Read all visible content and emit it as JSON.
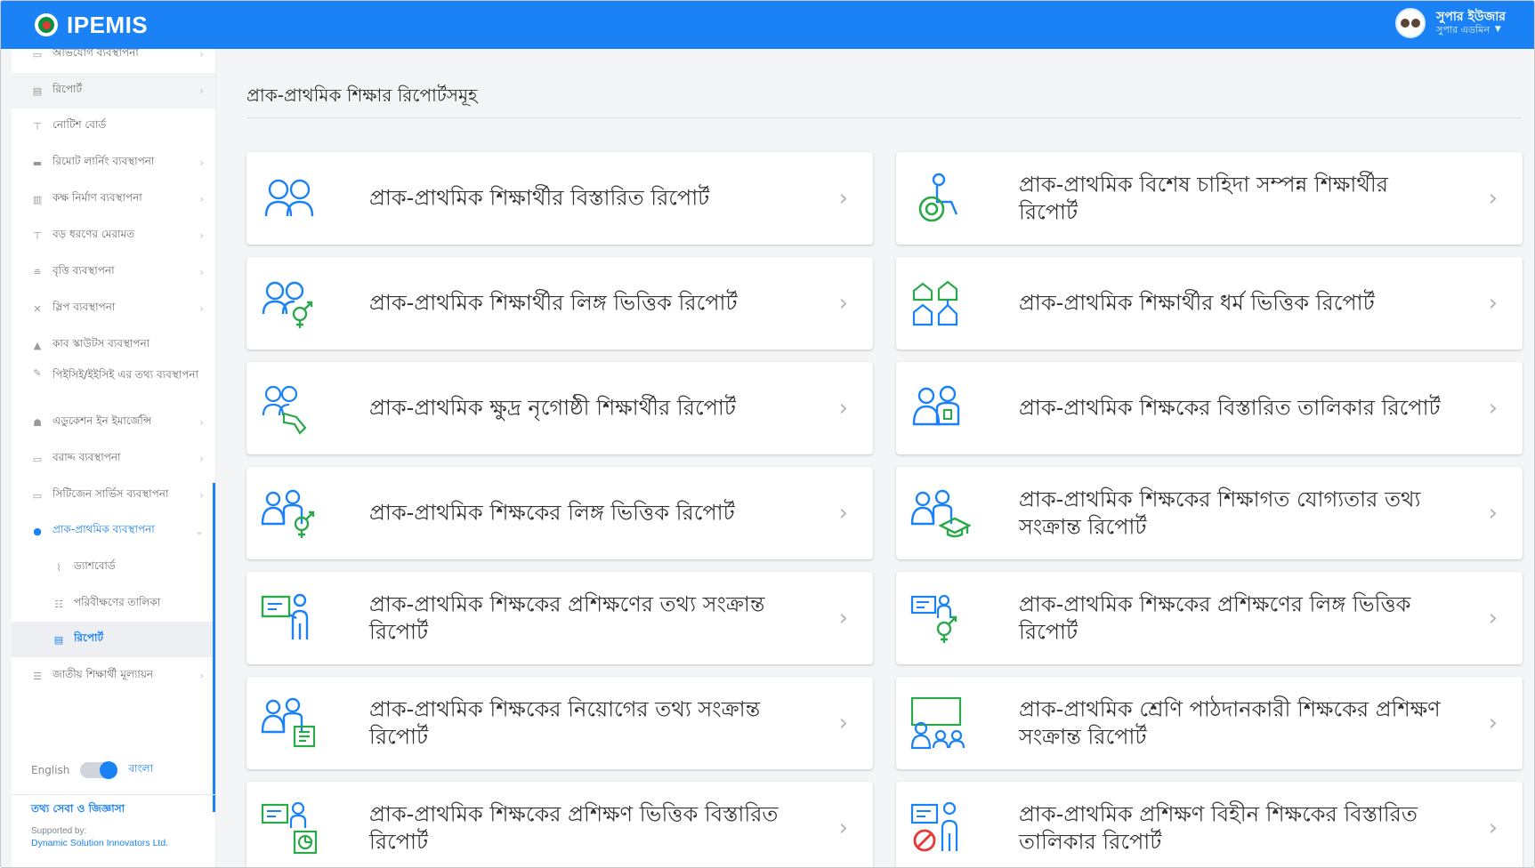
{
  "app": {
    "brand": "IPEMIS"
  },
  "user": {
    "name": "সুপার ইউজার",
    "role": "সুপার এডমিন"
  },
  "sidebar": {
    "items": [
      {
        "label": "অভিযোগ ব্যবস্থাপনা",
        "icon": "complaint-icon"
      },
      {
        "label": "রিপোর্ট",
        "icon": "report-icon"
      },
      {
        "label": "নোটিশ বোর্ড",
        "icon": "pin-icon"
      },
      {
        "label": "রিমোট লার্নিং ব্যবস্থাপনা",
        "icon": "folder-icon"
      },
      {
        "label": "কক্ষ নির্মাণ ব্যবস্থাপনা",
        "icon": "building-icon"
      },
      {
        "label": "বড় ধরণের মেরামত",
        "icon": "repair-icon"
      },
      {
        "label": "বৃত্তি ব্যবস্থাপনা",
        "icon": "scholarship-icon"
      },
      {
        "label": "স্লিপ ব্যবস্থাপনা",
        "icon": "tools-icon"
      },
      {
        "label": "কাব স্কাউটস ব্যবস্থাপনা",
        "icon": "tent-icon"
      },
      {
        "label": "পিইসিই/ইইসিই এর তথ্য ব্যবস্থাপনা",
        "icon": "edit-icon"
      },
      {
        "label": "এডুকেশন ইন ইমার্জেন্সি",
        "icon": "emergency-icon"
      },
      {
        "label": "বরাদ্দ ব্যবস্থাপনা",
        "icon": "allocation-icon"
      },
      {
        "label": "সিটিজেন সার্ভিস ব্যবস্থাপনা",
        "icon": "service-icon"
      },
      {
        "label": "প্রাক-প্রাথমিক ব্যবস্থাপনা",
        "icon": "pre-primary-icon"
      },
      {
        "label": "ড্যাশবোর্ড",
        "icon": "chart-line-icon"
      },
      {
        "label": "পরিবীক্ষণের তালিকা",
        "icon": "list-icon"
      },
      {
        "label": "রিপোর্ট",
        "icon": "report-icon"
      },
      {
        "label": "জাতীয় শিক্ষার্থী মূল্যায়ন",
        "icon": "assessment-icon"
      }
    ],
    "lang_en": "English",
    "lang_bn": "বাংলা",
    "footer_link": "তথ্য সেবা ও জিজ্ঞাসা",
    "supported_by": "Supported by:",
    "company": "Dynamic Solution Innovators Ltd."
  },
  "main": {
    "title": "প্রাক-প্রাথমিক শিক্ষার রিপোর্টসমূহ",
    "cards": [
      {
        "label": "প্রাক-প্রাথমিক শিক্ষার্থীর বিস্তারিত রিপোর্ট",
        "icon": "students-icon"
      },
      {
        "label": "প্রাক-প্রাথমিক বিশেষ চাহিদা সম্পন্ন শিক্ষার্থীর রিপোর্ট",
        "icon": "wheelchair-icon"
      },
      {
        "label": "প্রাক-প্রাথমিক শিক্ষার্থীর লিঙ্গ ভিত্তিক রিপোর্ট",
        "icon": "students-gender-icon"
      },
      {
        "label": "প্রাক-প্রাথমিক শিক্ষার্থীর ধর্ম ভিত্তিক রিপোর্ট",
        "icon": "religion-icon"
      },
      {
        "label": "প্রাক-প্রাথমিক ক্ষুদ্র নৃগোষ্ঠী শিক্ষার্থীর রিপোর্ট",
        "icon": "ethnic-students-icon"
      },
      {
        "label": "প্রাক-প্রাথমিক শিক্ষকের বিস্তারিত তালিকার রিপোর্ট",
        "icon": "teachers-icon"
      },
      {
        "label": "প্রাক-প্রাথমিক শিক্ষকের লিঙ্গ ভিত্তিক রিপোর্ট",
        "icon": "teachers-gender-icon"
      },
      {
        "label": "প্রাক-প্রাথমিক শিক্ষকের শিক্ষাগত যোগ্যতার তথ্য সংক্রান্ত রিপোর্ট",
        "icon": "teachers-graduation-icon"
      },
      {
        "label": "প্রাক-প্রাথমিক শিক্ষকের প্রশিক্ষণের তথ্য সংক্রান্ত রিপোর্ট",
        "icon": "training-icon"
      },
      {
        "label": "প্রাক-প্রাথমিক শিক্ষকের প্রশিক্ষণের লিঙ্গ ভিত্তিক রিপোর্ট",
        "icon": "training-gender-icon"
      },
      {
        "label": "প্রাক-প্রাথমিক শিক্ষকের নিয়োগের তথ্য সংক্রান্ত রিপোর্ট",
        "icon": "recruitment-icon"
      },
      {
        "label": "প্রাক-প্রাথমিক শ্রেণি পাঠদানকারী শিক্ষকের প্রশিক্ষণ সংক্রান্ত রিপোর্ট",
        "icon": "classroom-teacher-icon"
      },
      {
        "label": "প্রাক-প্রাথমিক শিক্ষকের প্রশিক্ষণ ভিত্তিক বিস্তারিত রিপোর্ট",
        "icon": "training-chart-icon"
      },
      {
        "label": "প্রাক-প্রাথমিক প্রশিক্ষণ বিহীন শিক্ষকের বিস্তারিত তালিকার রিপোর্ট",
        "icon": "no-training-icon"
      }
    ]
  },
  "colors": {
    "primary": "#1a82f5",
    "accent_green": "#2aa84a"
  }
}
